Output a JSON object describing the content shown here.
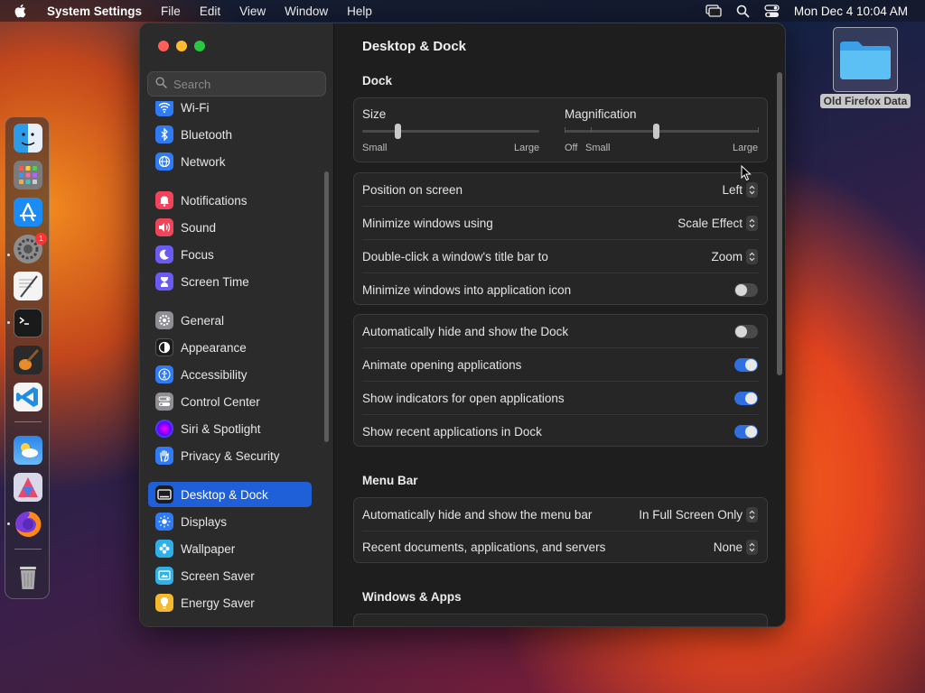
{
  "menubar": {
    "app": "System Settings",
    "menus": [
      "File",
      "Edit",
      "View",
      "Window",
      "Help"
    ],
    "clock": "Mon Dec 4  10:04 AM"
  },
  "desktop": {
    "folder_label": "Old Firefox Data"
  },
  "dock": {
    "apps": [
      "finder",
      "launchpad",
      "app-store",
      "system-settings",
      "textedit",
      "terminal",
      "garageband",
      "vscode",
      "weather",
      "affinity",
      "firefox",
      "trash"
    ],
    "settings_badge": "1"
  },
  "sidebar": {
    "search_placeholder": "Search",
    "items": [
      {
        "label": "Wi-Fi",
        "icon": "wifi-icon",
        "color": "#2f7bf5"
      },
      {
        "label": "Bluetooth",
        "icon": "bluetooth-icon",
        "color": "#2f7bf5"
      },
      {
        "label": "Network",
        "icon": "globe-icon",
        "color": "#2f7bf5"
      },
      {
        "label": "Notifications",
        "icon": "bell-icon",
        "color": "#f0445a"
      },
      {
        "label": "Sound",
        "icon": "speaker-icon",
        "color": "#f0445a"
      },
      {
        "label": "Focus",
        "icon": "moon-icon",
        "color": "#6a5cf0"
      },
      {
        "label": "Screen Time",
        "icon": "hourglass-icon",
        "color": "#6a5cf0"
      },
      {
        "label": "General",
        "icon": "gear-icon",
        "color": "#8e8e93"
      },
      {
        "label": "Appearance",
        "icon": "appearance-icon",
        "color": "#1c1c1e"
      },
      {
        "label": "Accessibility",
        "icon": "accessibility-icon",
        "color": "#2f7bf5"
      },
      {
        "label": "Control Center",
        "icon": "control-center-icon",
        "color": "#8e8e93"
      },
      {
        "label": "Siri & Spotlight",
        "icon": "siri-icon",
        "color": "#b04ce0"
      },
      {
        "label": "Privacy & Security",
        "icon": "hand-icon",
        "color": "#2f7bf5"
      },
      {
        "label": "Desktop & Dock",
        "icon": "dock-icon",
        "color": "#1c1c1e"
      },
      {
        "label": "Displays",
        "icon": "sun-icon",
        "color": "#2f7bf5"
      },
      {
        "label": "Wallpaper",
        "icon": "flower-icon",
        "color": "#2fb0e8"
      },
      {
        "label": "Screen Saver",
        "icon": "screensaver-icon",
        "color": "#2fb0e8"
      },
      {
        "label": "Energy Saver",
        "icon": "battery-icon",
        "color": "#f5b92f"
      }
    ]
  },
  "content": {
    "title": "Desktop & Dock",
    "dock_section": "Dock",
    "size_label": "Size",
    "size_min": "Small",
    "size_max": "Large",
    "size_value": 0.2,
    "magnification_label": "Magnification",
    "mag_off": "Off",
    "mag_min": "Small",
    "mag_max": "Large",
    "mag_value": 0.47,
    "rows1": [
      {
        "label": "Position on screen",
        "value": "Left"
      },
      {
        "label": "Minimize windows using",
        "value": "Scale Effect"
      },
      {
        "label": "Double-click a window's title bar to",
        "value": "Zoom"
      },
      {
        "label": "Minimize windows into application icon",
        "toggle": false
      }
    ],
    "rows2": [
      {
        "label": "Automatically hide and show the Dock",
        "toggle": false
      },
      {
        "label": "Animate opening applications",
        "toggle": true
      },
      {
        "label": "Show indicators for open applications",
        "toggle": true
      },
      {
        "label": "Show recent applications in Dock",
        "toggle": true
      }
    ],
    "menubar_section": "Menu Bar",
    "rows3": [
      {
        "label": "Automatically hide and show the menu bar",
        "value": "In Full Screen Only"
      },
      {
        "label": "Recent documents, applications, and servers",
        "value": "None"
      }
    ],
    "windows_section": "Windows & Apps"
  }
}
